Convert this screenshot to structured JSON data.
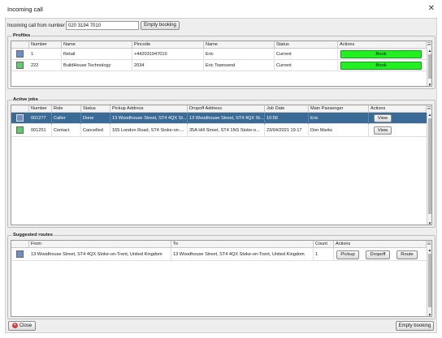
{
  "window": {
    "title": "Incoming call",
    "close_glyph": "✕"
  },
  "incoming": {
    "label": "Incoming call from number",
    "number": "020 3194 7010",
    "empty_booking_label": "Empty booking"
  },
  "profiles": {
    "label": "Profiles",
    "columns": [
      "Number",
      "Name",
      "Pincode",
      "Name",
      "Status",
      "Actions"
    ],
    "rows": [
      {
        "color": "#6f8fc4",
        "number": "1",
        "name": "Retail",
        "pincode": "+442031947010",
        "contact": "Eric",
        "status": "Current",
        "action": "Book"
      },
      {
        "color": "#5fcb6a",
        "number": "222",
        "name": "BuildHouse Technology",
        "pincode": "2034",
        "contact": "Eric Townsend",
        "status": "Current",
        "action": "Book"
      }
    ]
  },
  "active_jobs": {
    "label": "Active jobs",
    "columns": [
      "Number",
      "Role",
      "Status",
      "Pickup Address",
      "Dropoff Address",
      "Job Date",
      "Main Passenger",
      "Actions"
    ],
    "rows": [
      {
        "color": "#6f8fc4",
        "number": "001277",
        "role": "Caller",
        "status": "Done",
        "pickup": "13 Woodhouse Street, ST4 4QX St...",
        "dropoff": "13 Woodhouse Street, ST4 4QX St...",
        "date": "10:56",
        "passenger": "Eric",
        "action": "View",
        "selected": true
      },
      {
        "color": "#5fcb6a",
        "number": "001251",
        "role": "Contact",
        "status": "Cancelled",
        "pickup": "165 London Road, ST4 Stoke-on-...",
        "dropoff": "35A Hill Street, ST4 1NS Stoke-o...",
        "date": "23/04/2021 19:17",
        "passenger": "Don Marks",
        "action": "View",
        "selected": false
      }
    ]
  },
  "suggested_routes": {
    "label": "Suggested routes",
    "columns": [
      "From",
      "To",
      "Count",
      "Actions"
    ],
    "rows": [
      {
        "color": "#6f8fc4",
        "from": "13 Woodhouse Street, ST4 4QX Stoke-on-Trent, United Kingdom",
        "to": "13 Woodhouse Street, ST4 4QX Stoke-on-Trent, United Kingdom",
        "count": "1",
        "pickup_label": "Pickup",
        "dropoff_label": "Dropoff",
        "route_label": "Route"
      }
    ]
  },
  "footer": {
    "close_label": "Close",
    "empty_booking_label": "Empty booking"
  },
  "scroll": {
    "up": "▲",
    "down": "▼",
    "corner": "☷"
  }
}
